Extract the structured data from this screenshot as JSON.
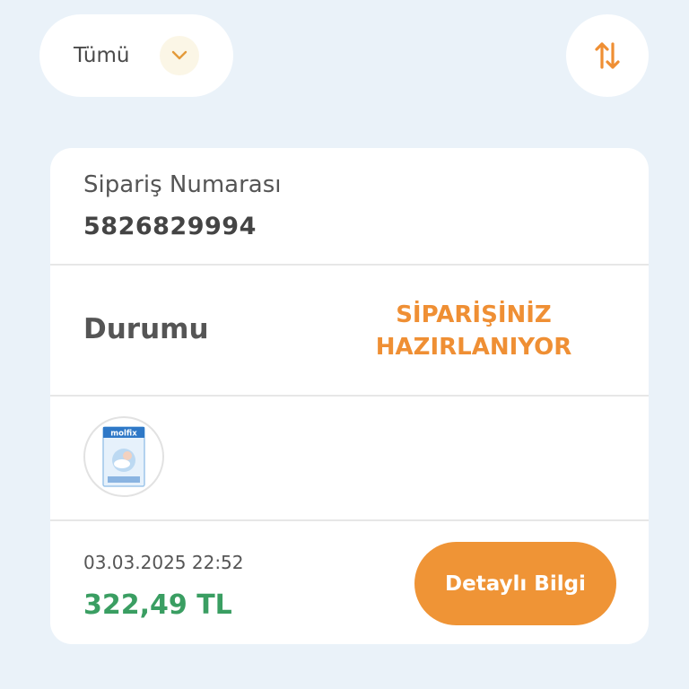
{
  "filter": {
    "label": "Tümü"
  },
  "order": {
    "number_label": "Sipariş Numarası",
    "number": "5826829994",
    "status_label": "Durumu",
    "status_value": "SİPARİŞİNİZ HAZIRLANIYOR",
    "product_brand": "molfix",
    "date": "03.03.2025 22:52",
    "price": "322,49 TL",
    "detail_button": "Detaylı Bilgi"
  },
  "colors": {
    "accent": "#ef9436",
    "price_green": "#3a9e62",
    "background": "#eaf2f9"
  },
  "icons": {
    "filter_dropdown": "chevron-down-icon",
    "sort": "sort-arrows-icon"
  }
}
